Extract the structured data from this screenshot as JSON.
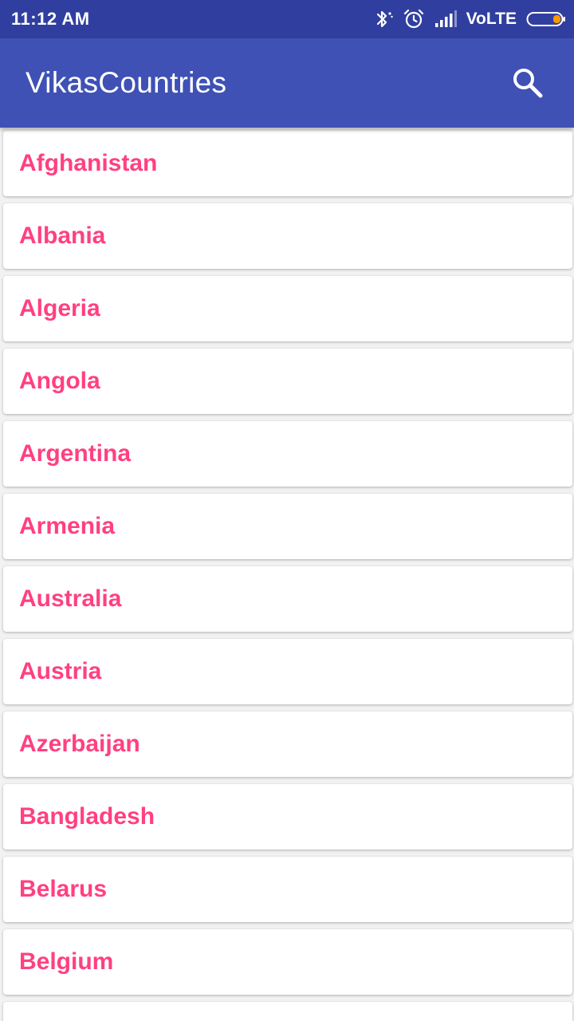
{
  "status_bar": {
    "time": "11:12 AM",
    "network_label": "VoLTE",
    "icons": [
      "bluetooth-icon",
      "alarm-icon",
      "signal-icon",
      "battery-icon"
    ]
  },
  "app_bar": {
    "title": "VikasCountries",
    "search_icon": "search-icon"
  },
  "colors": {
    "status_bar": "#303f9f",
    "app_bar": "#3f51b5",
    "accent_text": "#ff4081",
    "battery_fill": "#ff9800"
  },
  "countries": [
    "Afghanistan",
    "Albania",
    "Algeria",
    "Angola",
    "Argentina",
    "Armenia",
    "Australia",
    "Austria",
    "Azerbaijan",
    "Bangladesh",
    "Belarus",
    "Belgium",
    ""
  ]
}
